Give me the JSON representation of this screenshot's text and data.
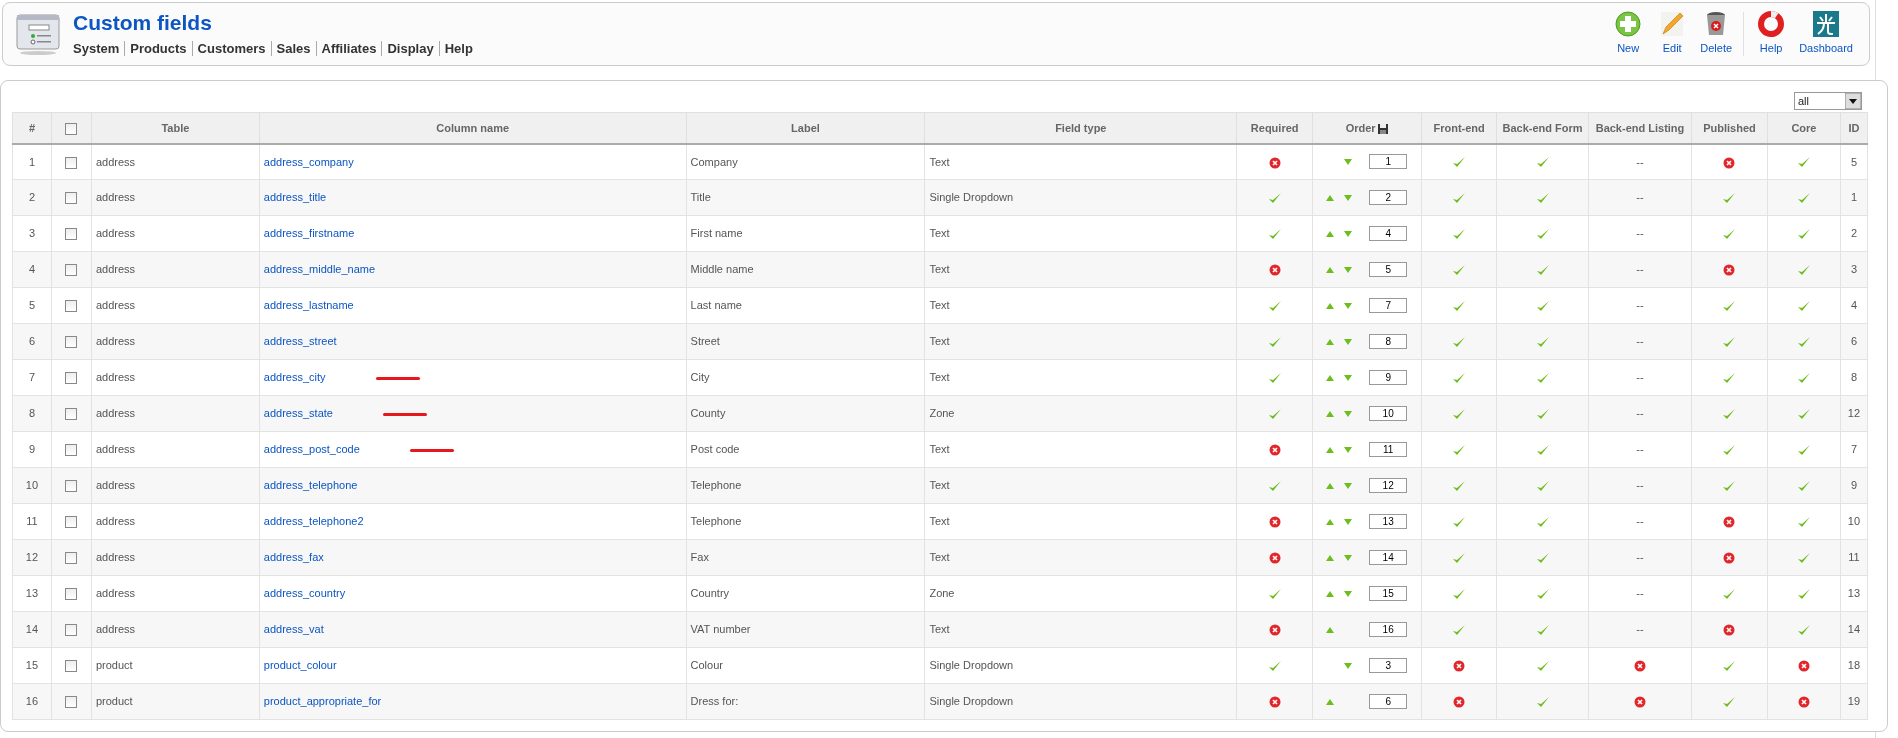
{
  "header": {
    "title": "Custom fields",
    "menu": [
      "System",
      "Products",
      "Customers",
      "Sales",
      "Affiliates",
      "Display",
      "Help"
    ],
    "toolbar": [
      {
        "kind": "new",
        "label": "New"
      },
      {
        "kind": "edit",
        "label": "Edit"
      },
      {
        "kind": "delete",
        "label": "Delete"
      },
      {
        "kind": "help",
        "label": "Help"
      },
      {
        "kind": "dashboard",
        "label": "Dashboard"
      }
    ]
  },
  "filter": {
    "value": "all"
  },
  "table": {
    "columns": [
      "#",
      "Table",
      "Column name",
      "Label",
      "Field type",
      "Required",
      "Order",
      "Front-end",
      "Back-end Form",
      "Back-end Listing",
      "Published",
      "Core",
      "ID"
    ],
    "select_all": {
      "checked": false
    },
    "rows": [
      {
        "num": "1",
        "checked": false,
        "table": "address",
        "column": "address_company",
        "underlined": false,
        "label": "Company",
        "type": "Text",
        "required": false,
        "up": false,
        "down": true,
        "order": "1",
        "front": true,
        "back_form": true,
        "back_listing": {
          "kind": "dash",
          "text": "--"
        },
        "published": false,
        "core": true,
        "id": "5"
      },
      {
        "num": "2",
        "checked": false,
        "table": "address",
        "column": "address_title",
        "underlined": false,
        "label": "Title",
        "type": "Single Dropdown",
        "required": true,
        "up": true,
        "down": true,
        "order": "2",
        "front": true,
        "back_form": true,
        "back_listing": {
          "kind": "dash",
          "text": "--"
        },
        "published": true,
        "core": true,
        "id": "1"
      },
      {
        "num": "3",
        "checked": false,
        "table": "address",
        "column": "address_firstname",
        "underlined": false,
        "label": "First name",
        "type": "Text",
        "required": true,
        "up": true,
        "down": true,
        "order": "4",
        "front": true,
        "back_form": true,
        "back_listing": {
          "kind": "dash",
          "text": "--"
        },
        "published": true,
        "core": true,
        "id": "2"
      },
      {
        "num": "4",
        "checked": false,
        "table": "address",
        "column": "address_middle_name",
        "underlined": false,
        "label": "Middle name",
        "type": "Text",
        "required": false,
        "up": true,
        "down": true,
        "order": "5",
        "front": true,
        "back_form": true,
        "back_listing": {
          "kind": "dash",
          "text": "--"
        },
        "published": false,
        "core": true,
        "id": "3"
      },
      {
        "num": "5",
        "checked": false,
        "table": "address",
        "column": "address_lastname",
        "underlined": false,
        "label": "Last name",
        "type": "Text",
        "required": true,
        "up": true,
        "down": true,
        "order": "7",
        "front": true,
        "back_form": true,
        "back_listing": {
          "kind": "dash",
          "text": "--"
        },
        "published": true,
        "core": true,
        "id": "4"
      },
      {
        "num": "6",
        "checked": false,
        "table": "address",
        "column": "address_street",
        "underlined": false,
        "label": "Street",
        "type": "Text",
        "required": true,
        "up": true,
        "down": true,
        "order": "8",
        "front": true,
        "back_form": true,
        "back_listing": {
          "kind": "dash",
          "text": "--"
        },
        "published": true,
        "core": true,
        "id": "6"
      },
      {
        "num": "7",
        "checked": false,
        "table": "address",
        "column": "address_city",
        "underlined": true,
        "label": "City",
        "type": "Text",
        "required": true,
        "up": true,
        "down": true,
        "order": "9",
        "front": true,
        "back_form": true,
        "back_listing": {
          "kind": "dash",
          "text": "--"
        },
        "published": true,
        "core": true,
        "id": "8"
      },
      {
        "num": "8",
        "checked": false,
        "table": "address",
        "column": "address_state",
        "underlined": true,
        "label": "County",
        "type": "Zone",
        "required": true,
        "up": true,
        "down": true,
        "order": "10",
        "front": true,
        "back_form": true,
        "back_listing": {
          "kind": "dash",
          "text": "--"
        },
        "published": true,
        "core": true,
        "id": "12"
      },
      {
        "num": "9",
        "checked": false,
        "table": "address",
        "column": "address_post_code",
        "underlined": true,
        "label": "Post code",
        "type": "Text",
        "required": false,
        "up": true,
        "down": true,
        "order": "11",
        "front": true,
        "back_form": true,
        "back_listing": {
          "kind": "dash",
          "text": "--"
        },
        "published": true,
        "core": true,
        "id": "7"
      },
      {
        "num": "10",
        "checked": false,
        "table": "address",
        "column": "address_telephone",
        "underlined": false,
        "label": "Telephone",
        "type": "Text",
        "required": true,
        "up": true,
        "down": true,
        "order": "12",
        "front": true,
        "back_form": true,
        "back_listing": {
          "kind": "dash",
          "text": "--"
        },
        "published": true,
        "core": true,
        "id": "9"
      },
      {
        "num": "11",
        "checked": false,
        "table": "address",
        "column": "address_telephone2",
        "underlined": false,
        "label": "Telephone",
        "type": "Text",
        "required": false,
        "up": true,
        "down": true,
        "order": "13",
        "front": true,
        "back_form": true,
        "back_listing": {
          "kind": "dash",
          "text": "--"
        },
        "published": false,
        "core": true,
        "id": "10"
      },
      {
        "num": "12",
        "checked": false,
        "table": "address",
        "column": "address_fax",
        "underlined": false,
        "label": "Fax",
        "type": "Text",
        "required": false,
        "up": true,
        "down": true,
        "order": "14",
        "front": true,
        "back_form": true,
        "back_listing": {
          "kind": "dash",
          "text": "--"
        },
        "published": false,
        "core": true,
        "id": "11"
      },
      {
        "num": "13",
        "checked": false,
        "table": "address",
        "column": "address_country",
        "underlined": false,
        "label": "Country",
        "type": "Zone",
        "required": true,
        "up": true,
        "down": true,
        "order": "15",
        "front": true,
        "back_form": true,
        "back_listing": {
          "kind": "dash",
          "text": "--"
        },
        "published": true,
        "core": true,
        "id": "13"
      },
      {
        "num": "14",
        "checked": false,
        "table": "address",
        "column": "address_vat",
        "underlined": false,
        "label": "VAT number",
        "type": "Text",
        "required": false,
        "up": true,
        "down": false,
        "order": "16",
        "front": true,
        "back_form": true,
        "back_listing": {
          "kind": "dash",
          "text": "--"
        },
        "published": false,
        "core": true,
        "id": "14"
      },
      {
        "num": "15",
        "checked": false,
        "table": "product",
        "column": "product_colour",
        "underlined": false,
        "label": "Colour",
        "type": "Single Dropdown",
        "required": true,
        "up": false,
        "down": true,
        "order": "3",
        "front": false,
        "back_form": true,
        "back_listing": {
          "kind": "flag",
          "on": false
        },
        "published": true,
        "core": false,
        "id": "18"
      },
      {
        "num": "16",
        "checked": false,
        "table": "product",
        "column": "product_appropriate_for",
        "underlined": false,
        "label": "Dress for:",
        "type": "Single Dropdown",
        "required": false,
        "up": true,
        "down": false,
        "order": "6",
        "front": false,
        "back_form": true,
        "back_listing": {
          "kind": "flag",
          "on": false
        },
        "published": true,
        "core": false,
        "id": "19"
      }
    ]
  }
}
